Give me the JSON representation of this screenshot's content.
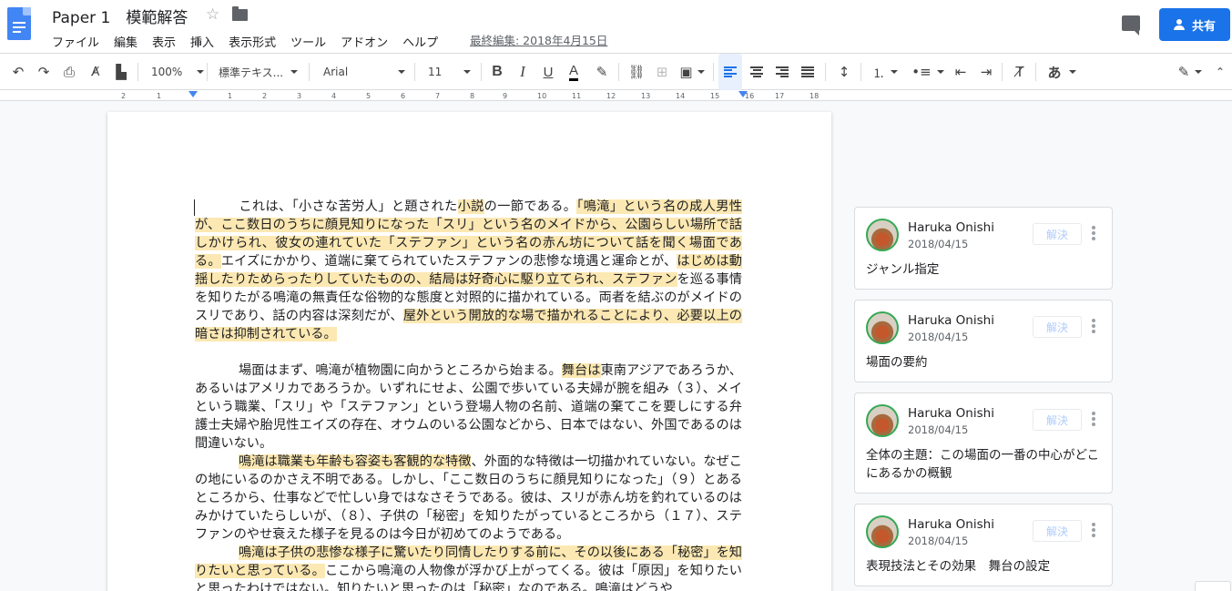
{
  "header": {
    "title": "Paper 1　模範解答",
    "menu": [
      "ファイル",
      "編集",
      "表示",
      "挿入",
      "表示形式",
      "ツール",
      "アドオン",
      "ヘルプ"
    ],
    "last_edit": "最終編集: 2018年4月15日",
    "share_label": "共有"
  },
  "toolbar": {
    "zoom": "100%",
    "style": "標準テキス...",
    "font": "Arial",
    "size": "11",
    "bold": "B",
    "italic": "I",
    "underline": "U",
    "text_color": "A",
    "input_tool": "あ"
  },
  "ruler": {
    "ticks": [
      "2",
      "1",
      "1",
      "2",
      "3",
      "4",
      "5",
      "6",
      "7",
      "8",
      "9",
      "10",
      "11",
      "12",
      "13",
      "14",
      "15",
      "16",
      "17",
      "18"
    ]
  },
  "document": {
    "p1": {
      "a": "これは、「小さな苦労人」と題された",
      "b": "小説",
      "c": "の一節である。",
      "d": "「鳴滝」という名の成人男性が、ここ数日のうちに顔見知りになった「スリ」という名のメイドから、公園らしい場所で話しかけられ、彼女の連れていた「ステファン」という名の赤ん坊について話を聞く場面である。",
      "e": "エイズにかかり、道端に棄てられていたステファンの悲惨な境遇と運命とが、",
      "f": "はじめは動揺したりためらったりしていたものの、結局は好奇心に駆り立てられ、ステファン",
      "g": "を巡る事情を知りたがる鳴滝の無責任な俗物的な態度と対照的に描かれている。両者を結ぶのがメイドのスリであり、話の内容は深刻だが、",
      "h": "屋外という開放的な場で描かれることにより、必要以上の暗さは抑制されている。"
    },
    "p2": {
      "a": "場面はまず、鳴滝が植物園に向かうところから始まる。",
      "b": "舞台は",
      "c": "東南アジアであろうか、あるいはアメリカであろうか。いずれにせよ、公園で歩いている夫婦が腕を組み（３）、メイという職業、「スリ」や「ステファン」という登場人物の名前、道端の棄てこを要しにする弁護士夫婦や胎児性エイズの存在、オウムのいる公園などから、日本ではない、外国であるのは間違いない。"
    },
    "p3": {
      "a": "鳴滝は職業も年齢も容姿も客観的な特徴",
      "b": "、外面的な特徴は一切描かれていない。なぜこの地にいるのかさえ不明である。しかし、「ここ数日のうちに顔見知りになった」（９）とあるところから、仕事などで忙しい身ではなさそうである。彼は、スリが赤ん坊を釣れているのはみかけていたらしいが、（８）、子供の「秘密」を知りたがっているところから（１７）、ステファンのやせ衰えた様子を見るのは今日が初めてのようである。"
    },
    "p4": {
      "a": "鳴滝は子供の悲惨な様子に驚いたり同情したりする前に、その以後にある「秘密」を知りたいと思っている。",
      "b": "ここから鳴滝の人物像が浮かび上がってくる。彼は「原因」を知りたいと思ったわけではない。知りたいと思ったのは「秘密」なのである。鳴滝はどうや"
    }
  },
  "comments": [
    {
      "name": "Haruka Onishi",
      "date": "2018/04/15",
      "resolve": "解決",
      "text": "ジャンル指定"
    },
    {
      "name": "Haruka Onishi",
      "date": "2018/04/15",
      "resolve": "解決",
      "text": "場面の要約"
    },
    {
      "name": "Haruka Onishi",
      "date": "2018/04/15",
      "resolve": "解決",
      "text": "全体の主題：この場面の一番の中心がどこにあるかの概観"
    },
    {
      "name": "Haruka Onishi",
      "date": "2018/04/15",
      "resolve": "解決",
      "text": "表現技法とその効果　舞台の設定"
    }
  ],
  "colors": {
    "accent": "#1a73e8",
    "highlight": "#fce8b2",
    "doc_icon": "#4285f4"
  },
  "icons": [
    "docs-logo-icon",
    "star-icon",
    "folder-icon",
    "comment-icon",
    "share-person-icon",
    "undo-icon",
    "redo-icon",
    "print-icon",
    "spellcheck-icon",
    "paint-format-icon",
    "highlighter-icon",
    "link-icon",
    "add-comment-icon",
    "image-icon",
    "align-left-icon",
    "align-center-icon",
    "align-right-icon",
    "align-justify-icon",
    "line-spacing-icon",
    "numbered-list-icon",
    "bulleted-list-icon",
    "decrease-indent-icon",
    "increase-indent-icon",
    "clear-formatting-icon",
    "edit-mode-icon",
    "collapse-icon",
    "more-vert-icon"
  ]
}
